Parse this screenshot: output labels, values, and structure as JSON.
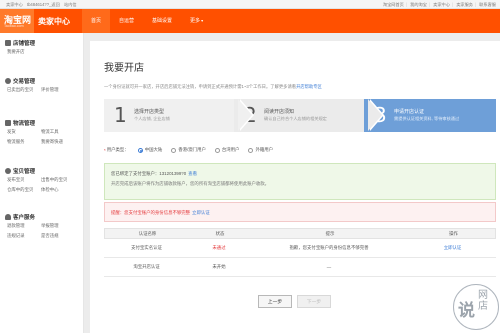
{
  "topbar": {
    "left": [
      "卖家中心",
      "tb484614??_返回",
      "站内信"
    ],
    "right": [
      "淘宝网首页",
      "我的淘宝",
      "卖家中心",
      "卖家服务",
      "联系客服"
    ]
  },
  "header": {
    "logo": "淘宝网",
    "logo_sub": "Taobao.com",
    "title": "卖家中心",
    "nav": [
      "首页",
      "自运营",
      "基础设置",
      "更多"
    ]
  },
  "sidebar": {
    "sections": [
      {
        "title": "店铺管理",
        "icon": "store-icon",
        "links": [
          "我要开店"
        ]
      },
      {
        "title": "交易管理",
        "icon": "trade-icon",
        "links": [
          "已卖出的宝贝",
          "评价管理"
        ]
      },
      {
        "title": "物流管理",
        "icon": "truck-icon",
        "links": [
          "发货",
          "物流工具",
          "物流服务",
          "我要寄快递"
        ]
      },
      {
        "title": "宝贝管理",
        "icon": "goods-icon",
        "links": [
          "发布宝贝",
          "出售中的宝贝",
          "仓库中的宝贝",
          "体检中心"
        ]
      },
      {
        "title": "客户服务",
        "icon": "service-icon",
        "links": [
          "退款管理",
          "举报管理",
          "违规记录",
          "是否违规"
        ]
      }
    ]
  },
  "main": {
    "title": "我要开店",
    "intro": "一个身份证就可开一家店，开店后店铺无法注销，申请到正式开通预计需1~3个工作日。了解更多请看",
    "intro_link": "开店帮助专区",
    "steps": [
      {
        "num": "1",
        "title": "选择开店类型",
        "desc": "个人店铺, 企业店铺"
      },
      {
        "num": "2",
        "title": "阅读开店须知",
        "desc": "确认自己符合个人店铺的相关规定"
      },
      {
        "num": "3",
        "title": "申请开店认证",
        "desc": "需提供认证相关资料, 等待审核通过"
      }
    ],
    "radio_label": "用户类型",
    "radios": [
      {
        "label": "中国大陆",
        "checked": true
      },
      {
        "label": "香港/澳门用户",
        "checked": false
      },
      {
        "label": "台湾用户",
        "checked": false
      },
      {
        "label": "外籍用户",
        "checked": false
      }
    ],
    "green_line1": "您已绑定了支付宝账户：131201399?0",
    "green_link": "查看",
    "green_line2": "开店完成后该账户将作为店铺收款账户，您的所有淘宝店铺都将使用此账户收款。",
    "red_text": "提醒：您支付宝账户的身份信息不够完整",
    "red_link": "立即认证",
    "table": {
      "headers": [
        "认证名称",
        "状态",
        "提示",
        "操作"
      ],
      "rows": [
        {
          "name": "支付宝实名认证",
          "status": "未通过",
          "tip": "抱歉，您支付宝账户的身份信息不够完善",
          "action": "立即认证"
        },
        {
          "name": "淘宝开店认证",
          "status": "未开始",
          "tip": "—",
          "action": ""
        }
      ]
    },
    "btn_prev": "上一步",
    "btn_next": "下一步"
  },
  "watermark": {
    "big": "说",
    "small": "网店"
  }
}
